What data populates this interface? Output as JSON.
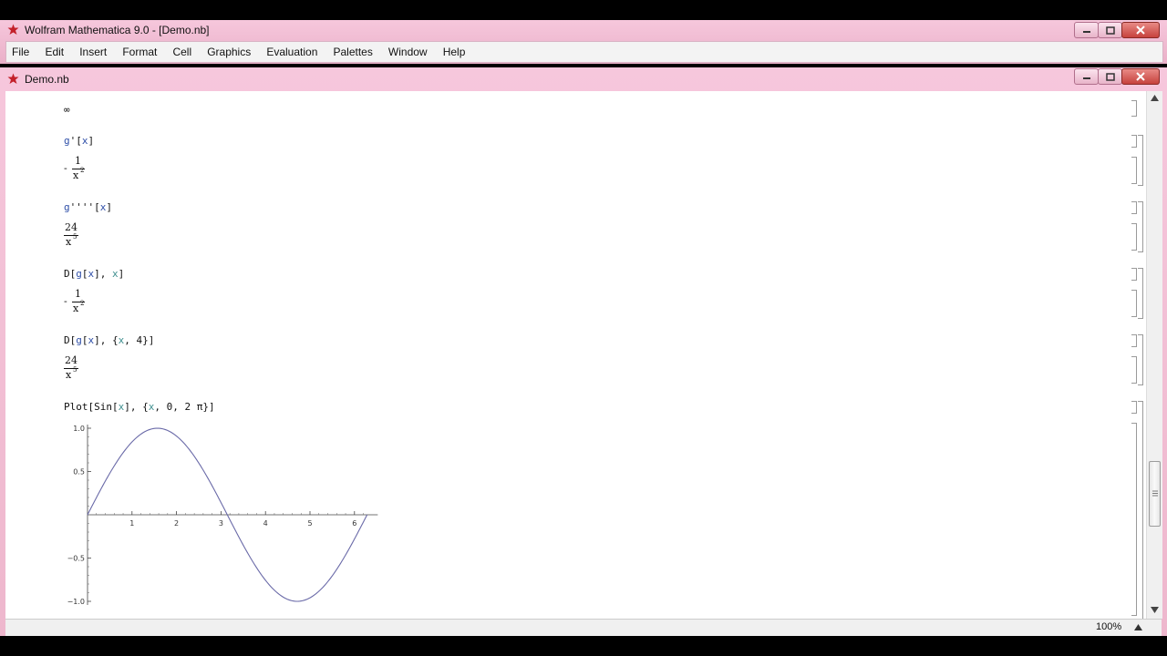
{
  "app": {
    "title": "Wolfram Mathematica 9.0 - [Demo.nb]",
    "accent_color": "#f3c1d7"
  },
  "menu": {
    "items": [
      "File",
      "Edit",
      "Insert",
      "Format",
      "Cell",
      "Graphics",
      "Evaluation",
      "Palettes",
      "Window",
      "Help"
    ]
  },
  "notebook": {
    "title": "Demo.nb",
    "zoom": "100%"
  },
  "cells": {
    "c0": {
      "output": "∞"
    },
    "c1": {
      "input_head": "g",
      "input_mid": "'[",
      "input_var": "x",
      "input_tail": "]",
      "out_sign": "-",
      "out_num": "1",
      "out_den": "x",
      "out_exp": "2"
    },
    "c2": {
      "input_head": "g",
      "input_mid": "''''[",
      "input_var": "x",
      "input_tail": "]",
      "out_num": "24",
      "out_den": "x",
      "out_exp": "5"
    },
    "c3": {
      "input_a": "D[",
      "input_b": "g",
      "input_c": "[",
      "input_d": "x",
      "input_e": "], ",
      "input_f": "x",
      "input_g": "]",
      "out_sign": "-",
      "out_num": "1",
      "out_den": "x",
      "out_exp": "2"
    },
    "c4": {
      "input_a": "D[",
      "input_b": "g",
      "input_c": "[",
      "input_d": "x",
      "input_e": "], {",
      "input_f": "x",
      "input_g": ", 4}]",
      "out_num": "24",
      "out_den": "x",
      "out_exp": "5"
    },
    "c5": {
      "input_a": "Plot[Sin[",
      "input_b": "x",
      "input_c": "], {",
      "input_d": "x",
      "input_e": ", 0, 2 π}]"
    }
  },
  "chart_data": {
    "type": "line",
    "title": "",
    "xlabel": "",
    "ylabel": "",
    "function": "Sin[x]",
    "x_range": [
      0,
      6.2832
    ],
    "xlim": [
      0,
      6.4
    ],
    "ylim": [
      -1.0,
      1.0
    ],
    "x_ticks": [
      "1",
      "2",
      "3",
      "4",
      "5",
      "6"
    ],
    "y_ticks": [
      "1.0",
      "0.5",
      "-0.5",
      "-1.0"
    ],
    "y_tick_values": [
      1.0,
      0.5,
      -0.5,
      -1.0
    ],
    "line_color": "#6a6aa8",
    "grid": false
  }
}
